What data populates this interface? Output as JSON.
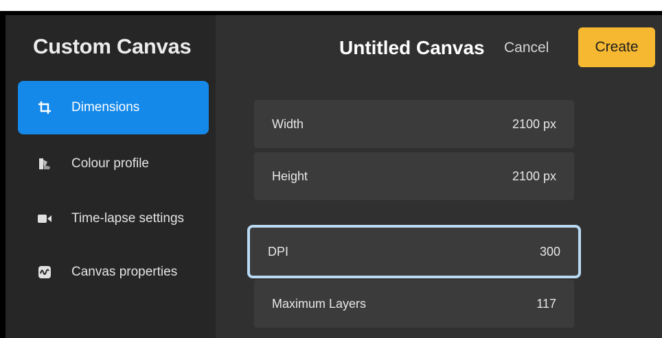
{
  "sidebar": {
    "title": "Custom Canvas",
    "items": [
      {
        "label": "Dimensions",
        "icon": "crop-icon",
        "active": true
      },
      {
        "label": "Colour profile",
        "icon": "colour-swatch-icon",
        "active": false
      },
      {
        "label": "Time-lapse settings",
        "icon": "video-camera-icon",
        "active": false
      },
      {
        "label": "Canvas properties",
        "icon": "canvas-properties-icon",
        "active": false
      }
    ]
  },
  "header": {
    "title": "Untitled Canvas",
    "cancel_label": "Cancel",
    "create_label": "Create"
  },
  "fields": [
    {
      "label": "Width",
      "value": "2100 px"
    },
    {
      "label": "Height",
      "value": "2100 px"
    },
    {
      "label": "DPI",
      "value": "300"
    },
    {
      "label": "Maximum Layers",
      "value": "117"
    }
  ],
  "colors": {
    "accent": "#1589ea",
    "create": "#f6b831",
    "highlight": "#b9daf3"
  }
}
